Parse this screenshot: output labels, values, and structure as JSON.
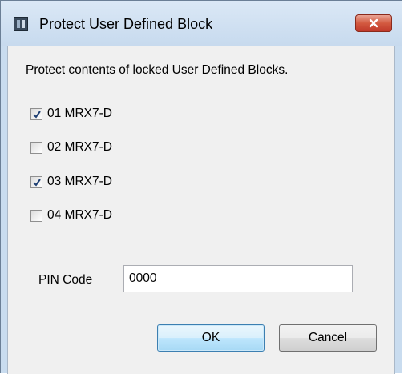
{
  "window": {
    "title": "Protect User Defined Block",
    "close_symbol": "close-icon"
  },
  "dialog": {
    "description": "Protect contents of locked User Defined Blocks.",
    "blocks": [
      {
        "label": "01 MRX7-D",
        "checked": true
      },
      {
        "label": "02 MRX7-D",
        "checked": false
      },
      {
        "label": "03 MRX7-D",
        "checked": true
      },
      {
        "label": "04 MRX7-D",
        "checked": false
      }
    ],
    "pin": {
      "label": "PIN Code",
      "value": "0000"
    },
    "buttons": {
      "ok": "OK",
      "cancel": "Cancel"
    }
  },
  "colors": {
    "titlebar": "#c9dcef",
    "close_button": "#c0392b",
    "dialog_background": "#f0f0f0",
    "checkmark": "#1e3f73",
    "default_button_border": "#3c7fb1"
  }
}
